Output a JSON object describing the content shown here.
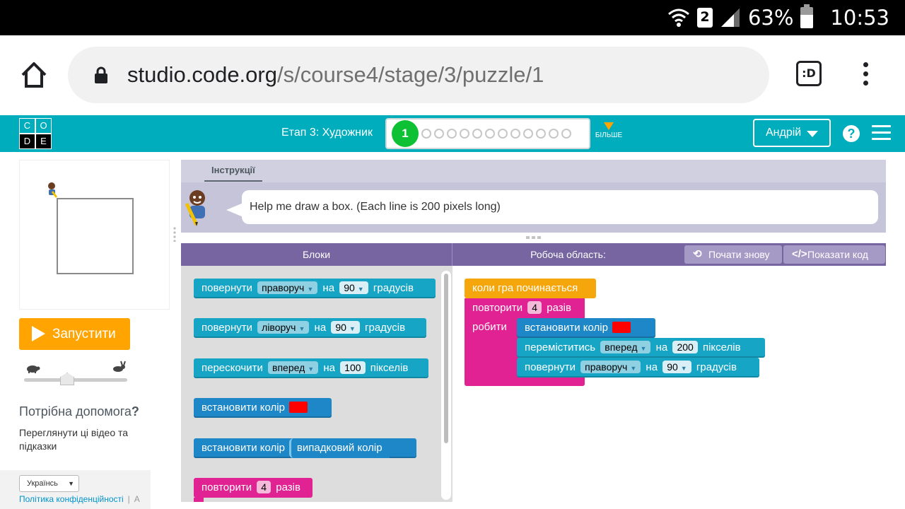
{
  "statusbar": {
    "battery_percent": "63%",
    "time": "10:53",
    "sim": "2"
  },
  "browser": {
    "url_domain": "studio.code.org",
    "url_path": "/s/course4/stage/3/puzzle/1",
    "tabs_label": ":D"
  },
  "header": {
    "stage_title": "Етап 3: Художник",
    "current_puzzle": "1",
    "more_label": "БІЛЬШЕ",
    "user_name": "Андрій",
    "help_label": "?"
  },
  "left": {
    "run_label": "Запустити",
    "help_title": "Потрібна допомога",
    "help_title_mark": "?",
    "help_text": "Переглянути ці відео та підказки",
    "language": "Українсь",
    "privacy_link": "Політика конфіденційності",
    "privacy_sep": "|",
    "privacy_next": "А"
  },
  "instructions": {
    "tab_label": "Інструкції",
    "text": "Help me draw a box. (Each line is 200 pixels long)"
  },
  "workspace_header": {
    "blocks_title": "Блоки",
    "workspace_title": "Робоча область:",
    "restart_label": "Почати знову",
    "show_code_label": "Показати код"
  },
  "toolbox": {
    "turn_right": {
      "lead": "повернути",
      "dir": "праворуч",
      "on": "на",
      "angle": "90",
      "unit": "градусів"
    },
    "turn_left": {
      "lead": "повернути",
      "dir": "ліворуч",
      "on": "на",
      "angle": "90",
      "unit": "градусів"
    },
    "jump": {
      "lead": "перескочити",
      "dir": "вперед",
      "on": "на",
      "dist": "100",
      "unit": "пікселів"
    },
    "set_color": {
      "lead": "встановити колір"
    },
    "set_random_color": {
      "lead": "встановити колір",
      "value": "випадковий колір"
    },
    "repeat": {
      "lead": "повторити",
      "count": "4",
      "unit": "разів"
    }
  },
  "program": {
    "when_run": "коли гра починається",
    "repeat": {
      "lead": "повторити",
      "count": "4",
      "unit": "разів",
      "do": "робити"
    },
    "set_color": {
      "lead": "встановити колір"
    },
    "move": {
      "lead": "переміститись",
      "dir": "вперед",
      "on": "на",
      "dist": "200",
      "unit": "пікселів"
    },
    "turn": {
      "lead": "повернути",
      "dir": "праворуч",
      "on": "на",
      "angle": "90",
      "unit": "градусів"
    }
  },
  "colors": {
    "header_bg": "#00adbc",
    "run_button": "#ffa400",
    "progress_current": "#0ec034",
    "workspace_header": "#7665a0",
    "block_teal": "#17a5c6",
    "block_blue": "#1e87c7",
    "block_pink": "#e12293",
    "block_orange": "#f5a60a",
    "pen_color": "#ff0000"
  }
}
